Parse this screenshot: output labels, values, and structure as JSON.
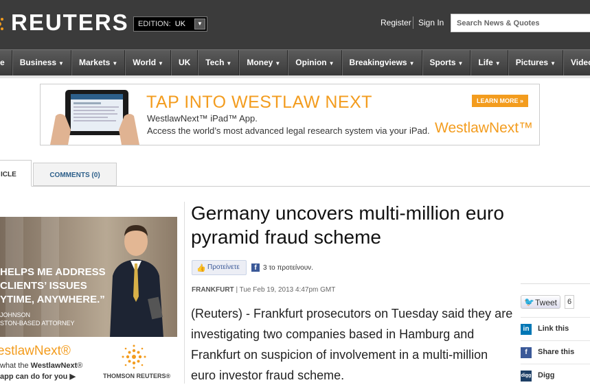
{
  "header": {
    "logo": "REUTERS",
    "edition_label": "EDITION:",
    "edition_value": "UK",
    "register": "Register",
    "sign_in": "Sign In",
    "search_placeholder": "Search News & Quotes"
  },
  "nav": {
    "items": [
      {
        "label": "e",
        "caret": false
      },
      {
        "label": "Business",
        "caret": true
      },
      {
        "label": "Markets",
        "caret": true
      },
      {
        "label": "World",
        "caret": true
      },
      {
        "label": "UK",
        "caret": false
      },
      {
        "label": "Tech",
        "caret": true
      },
      {
        "label": "Money",
        "caret": true
      },
      {
        "label": "Opinion",
        "caret": true
      },
      {
        "label": "Breakingviews",
        "caret": true
      },
      {
        "label": "Sports",
        "caret": true
      },
      {
        "label": "Life",
        "caret": true
      },
      {
        "label": "Pictures",
        "caret": true
      },
      {
        "label": "Video",
        "caret": true
      }
    ]
  },
  "banner_ad": {
    "headline": "TAP INTO WESTLAW NEXT",
    "line1": "WestlawNext™ iPad™ App.",
    "line2": "Access the world’s most advanced legal research system via your iPad.",
    "cta": "LEARN MORE »",
    "brand": "WestlawNext™",
    "accent_color": "#f39c1e"
  },
  "tabs": {
    "article": "ICLE",
    "comments": "COMMENTS (0)"
  },
  "side_ad": {
    "quote_line1": "HELPS ME ADDRESS",
    "quote_line2": "CLIENTS’ ISSUES",
    "quote_line3": "YTIME, ANYWHERE.”",
    "attribution_line1": "JOHNSON",
    "attribution_line2": "STON-BASED ATTORNEY",
    "brand": "estlawNext®",
    "line1": "what the WestlawNext® app can do for you ▶",
    "line2": "app can do for you ▶",
    "tr_text": "THOMSON REUTERS®"
  },
  "article": {
    "headline": "Germany uncovers multi-million euro pyramid fraud scheme",
    "like_label": "Προτείνετε",
    "fb_count": "3 το προτείνουν.",
    "location": "FRANKFURT",
    "date": "| Tue Feb 19, 2013 4:47pm GMT",
    "body": "(Reuters) - Frankfurt prosecutors on Tuesday said they are investigating two companies based in Hamburg and Frankfurt on suspicion of involvement in a multi-million euro investor fraud scheme."
  },
  "share": {
    "tweet_label": "Tweet",
    "tweet_count": "6",
    "items": [
      {
        "label": "Link this",
        "icon": "linkedin-icon",
        "color": "#0077b5",
        "glyph": "in"
      },
      {
        "label": "Share this",
        "icon": "facebook-icon",
        "color": "#3b5998",
        "glyph": "f"
      },
      {
        "label": "Digg",
        "icon": "digg-icon",
        "color": "#1d3f66",
        "glyph": "digg"
      }
    ]
  }
}
